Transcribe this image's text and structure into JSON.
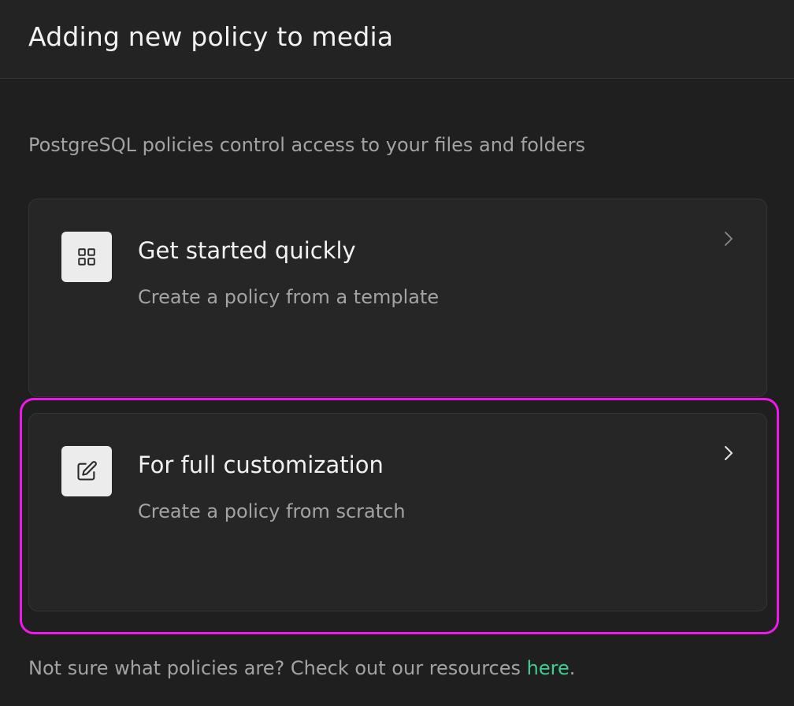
{
  "header": {
    "title": "Adding new policy to media"
  },
  "description": "PostgreSQL policies control access to your files and folders",
  "cards": [
    {
      "title": "Get started quickly",
      "subtitle": "Create a policy from a template",
      "icon": "grid-icon",
      "chevron": "chevron-right-icon"
    },
    {
      "title": "For full customization",
      "subtitle": "Create a policy from scratch",
      "icon": "edit-icon",
      "chevron": "chevron-right-icon"
    }
  ],
  "footer": {
    "text": "Not sure what policies are? Check out our resources ",
    "link": "here",
    "suffix": "."
  },
  "colors": {
    "background": "#1f1f1f",
    "card": "#262626",
    "link": "#3ecf8e",
    "highlight": "#f018e8"
  }
}
